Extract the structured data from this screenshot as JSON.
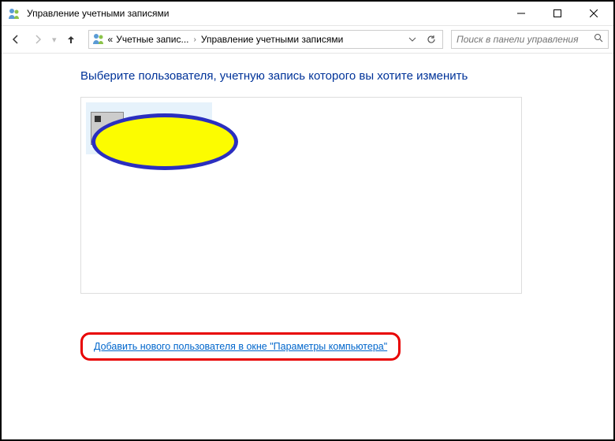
{
  "window": {
    "title": "Управление учетными записями"
  },
  "address": {
    "prefix": "«",
    "crumb1": "Учетные запис...",
    "crumb2": "Управление учетными записями"
  },
  "search": {
    "placeholder": "Поиск в панели управления"
  },
  "page": {
    "heading": "Выберите пользователя, учетную запись которого вы хотите изменить",
    "add_user_link": "Добавить нового пользователя в окне \"Параметры компьютера\""
  }
}
